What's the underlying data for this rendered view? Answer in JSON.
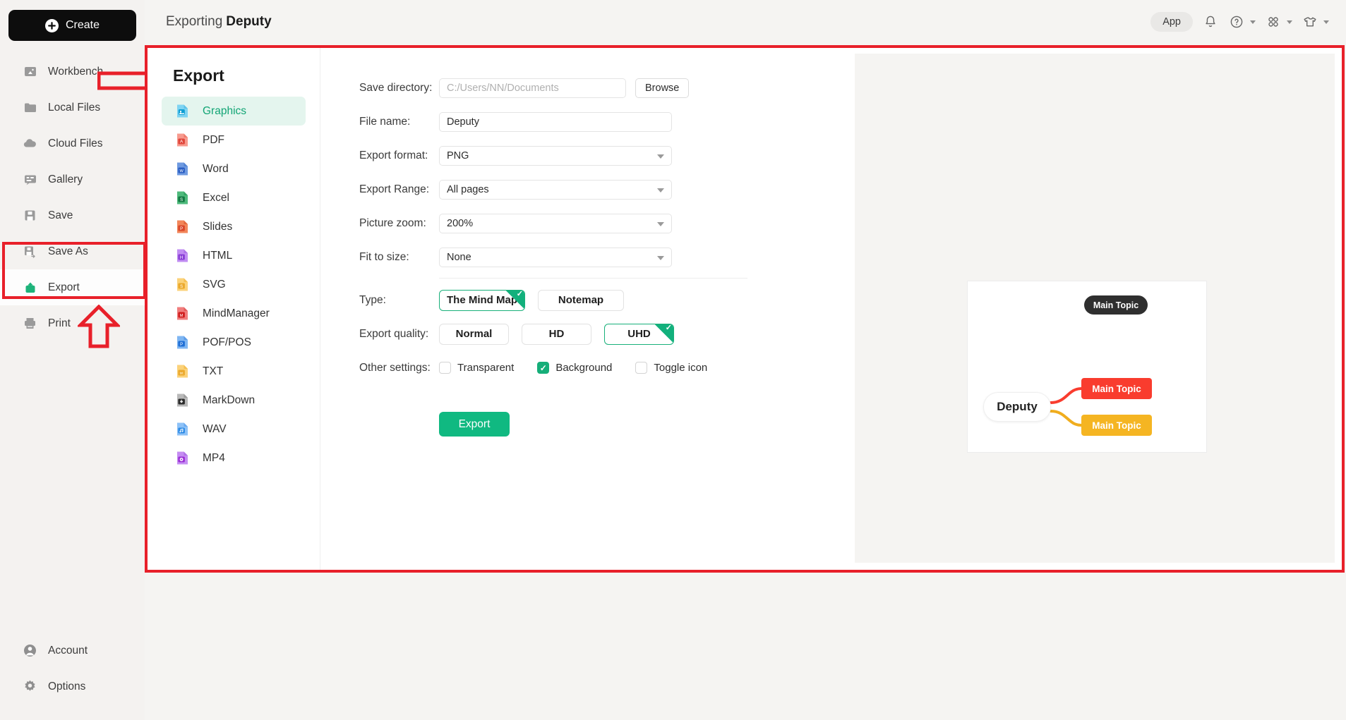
{
  "sidebar": {
    "create_label": "Create",
    "items": [
      {
        "label": "Workbench",
        "icon": "workbench-icon"
      },
      {
        "label": "Local Files",
        "icon": "folder-icon"
      },
      {
        "label": "Cloud Files",
        "icon": "cloud-icon"
      },
      {
        "label": "Gallery",
        "icon": "gallery-icon"
      },
      {
        "label": "Save",
        "icon": "save-icon"
      },
      {
        "label": "Save As",
        "icon": "save-as-icon"
      },
      {
        "label": "Export",
        "icon": "export-icon"
      },
      {
        "label": "Print",
        "icon": "print-icon"
      }
    ],
    "bottom_items": [
      {
        "label": "Account",
        "icon": "account-icon"
      },
      {
        "label": "Options",
        "icon": "gear-icon"
      }
    ]
  },
  "topbar": {
    "prefix": "Exporting",
    "doc_name": "Deputy",
    "app_label": "App",
    "icons": [
      "bell-icon",
      "help-icon",
      "apps-grid-icon",
      "theme-shirt-icon"
    ]
  },
  "export_panel": {
    "title": "Export",
    "formats": [
      {
        "label": "Graphics",
        "icon": "graphics-file-icon",
        "selected": true
      },
      {
        "label": "PDF",
        "icon": "pdf-file-icon",
        "selected": false
      },
      {
        "label": "Word",
        "icon": "word-file-icon",
        "selected": false
      },
      {
        "label": "Excel",
        "icon": "excel-file-icon",
        "selected": false
      },
      {
        "label": "Slides",
        "icon": "slides-file-icon",
        "selected": false
      },
      {
        "label": "HTML",
        "icon": "html-file-icon",
        "selected": false
      },
      {
        "label": "SVG",
        "icon": "svg-file-icon",
        "selected": false
      },
      {
        "label": "MindManager",
        "icon": "mindmanager-file-icon",
        "selected": false
      },
      {
        "label": "POF/POS",
        "icon": "pof-file-icon",
        "selected": false
      },
      {
        "label": "TXT",
        "icon": "txt-file-icon",
        "selected": false
      },
      {
        "label": "MarkDown",
        "icon": "markdown-file-icon",
        "selected": false
      },
      {
        "label": "WAV",
        "icon": "wav-file-icon",
        "selected": false
      },
      {
        "label": "MP4",
        "icon": "mp4-file-icon",
        "selected": false
      }
    ],
    "form": {
      "save_directory": {
        "label": "Save directory:",
        "value": "",
        "placeholder": "C:/Users/NN/Documents"
      },
      "browse_label": "Browse",
      "file_name": {
        "label": "File name:",
        "value": "Deputy"
      },
      "export_format": {
        "label": "Export format:",
        "value": "PNG"
      },
      "export_range": {
        "label": "Export Range:",
        "value": "All pages"
      },
      "picture_zoom": {
        "label": "Picture zoom:",
        "value": "200%"
      },
      "fit_to_size": {
        "label": "Fit to size:",
        "value": "None"
      },
      "type": {
        "label": "Type:",
        "options": [
          "The Mind Map",
          "Notemap"
        ],
        "selected": "The Mind Map"
      },
      "export_quality": {
        "label": "Export quality:",
        "options": [
          "Normal",
          "HD",
          "UHD"
        ],
        "selected": "UHD"
      },
      "other_settings": {
        "label": "Other settings:",
        "checkboxes": [
          {
            "label": "Transparent",
            "checked": false
          },
          {
            "label": "Background",
            "checked": true
          },
          {
            "label": "Toggle icon",
            "checked": false
          }
        ]
      },
      "export_button": "Export"
    }
  },
  "preview": {
    "root_node": "Deputy",
    "nodes": [
      {
        "label": "Main Topic",
        "color": "#2f2f2f"
      },
      {
        "label": "Main Topic",
        "color": "#f93c2e"
      },
      {
        "label": "Main Topic",
        "color": "#f5b522"
      }
    ]
  },
  "colors": {
    "accent_green": "#10b981",
    "annotation_red": "#e8202a",
    "sidebar_bg": "#f4f2f0"
  }
}
